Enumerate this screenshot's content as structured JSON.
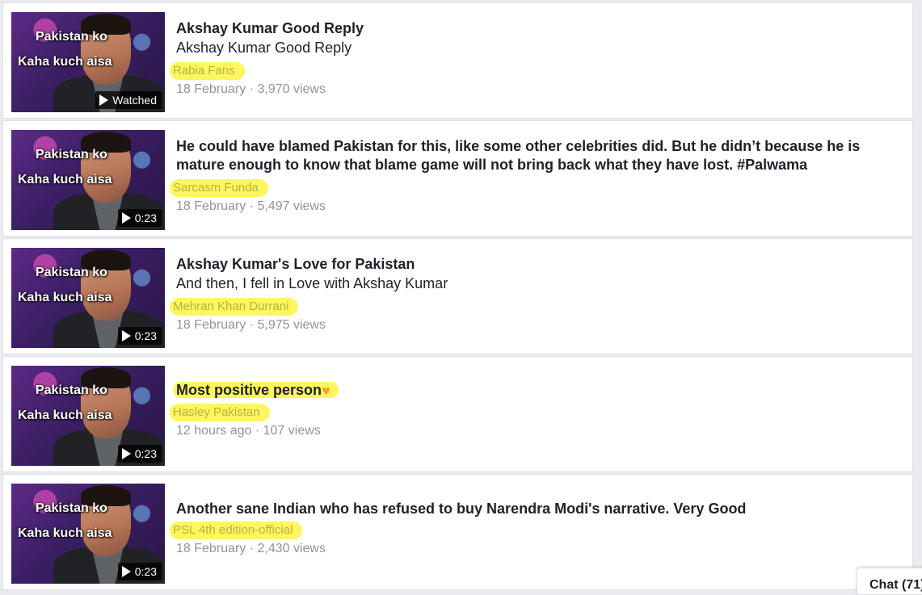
{
  "thumbnail_caption": {
    "line1": "Pakistan ko",
    "line2": "Kaha kuch aisa"
  },
  "videos": [
    {
      "title": "Akshay Kumar Good Reply",
      "subtitle": "Akshay Kumar Good Reply",
      "channel": "Rabia Fans",
      "date": "18 February",
      "views": "3,970 views",
      "badge": "Watched"
    },
    {
      "title": "He could have blamed Pakistan for this, like some other celebrities did. But he didn’t because he is mature enough to know that blame game will not bring back what they have lost. #Palwama",
      "subtitle": "",
      "channel": "Sarcasm Funda",
      "date": "18 February",
      "views": "5,497 views",
      "badge": "0:23"
    },
    {
      "title": "Akshay Kumar's Love for Pakistan",
      "subtitle": "And then, I fell in Love with Akshay Kumar",
      "channel": "Mehran Khan Durrani",
      "date": "18 February",
      "views": "5,975 views",
      "badge": "0:23"
    },
    {
      "title": "Most positive person",
      "subtitle": "",
      "channel": "Hasley Pakistan",
      "date": "12 hours ago",
      "views": "107 views",
      "badge": "0:23",
      "title_icon": "orange-heart-icon"
    },
    {
      "title": "Another sane Indian who has refused to buy Narendra Modi's narrative. Very Good",
      "subtitle": "",
      "channel": "PSL 4th edition-official",
      "date": "18 February",
      "views": "2,430 views",
      "badge": "0:23"
    }
  ],
  "separator": " · ",
  "chat": {
    "label": "Chat (71)"
  },
  "colors": {
    "highlight": "#fdf65c",
    "meta": "#90949c",
    "heart": "#f4a026"
  }
}
